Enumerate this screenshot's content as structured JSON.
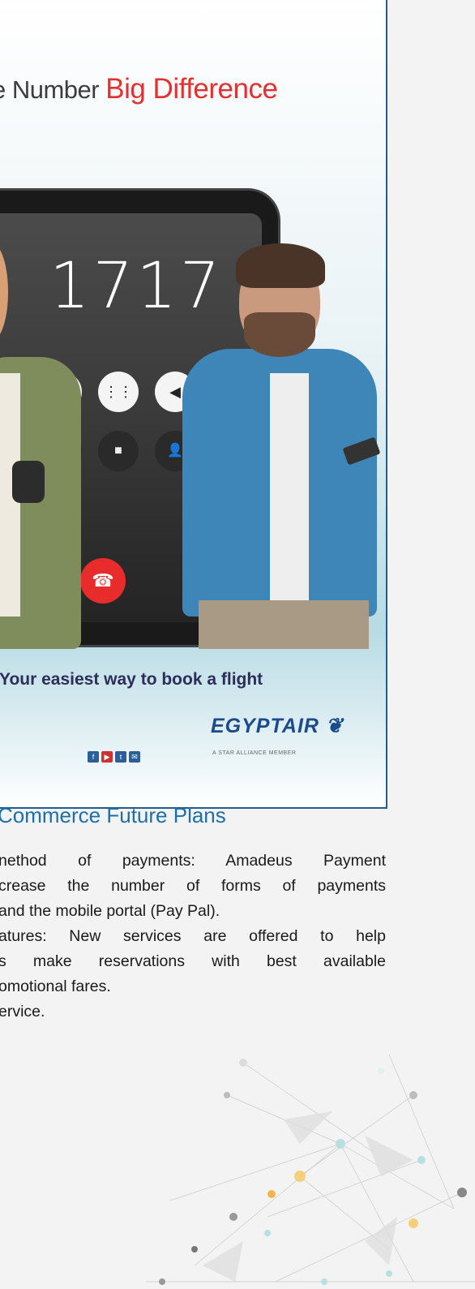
{
  "ad": {
    "headline_prefix": "e Number ",
    "headline_highlight": "Big Difference",
    "phone_number": "1717",
    "tagline": "Your easiest way to book a flight",
    "logo_text": "EGYPTAIR",
    "alliance_text": "A STAR ALLIANCE MEMBER",
    "social_icons": [
      "f",
      "▶",
      "t",
      "✉"
    ]
  },
  "section": {
    "title": "Commerce Future Plans",
    "lines": [
      "nethod of payments: Amadeus Payment",
      "crease the number of forms of payments",
      "and the mobile portal (Pay Pal).",
      "atures: New services are offered to help",
      "s make reservations with best available",
      "omotional fares.",
      "ervice."
    ]
  },
  "colors": {
    "border": "#1f5d8d",
    "highlight_red": "#e23131",
    "section_title_blue": "#1c6fa8",
    "end_call_red": "#e82b2b"
  }
}
